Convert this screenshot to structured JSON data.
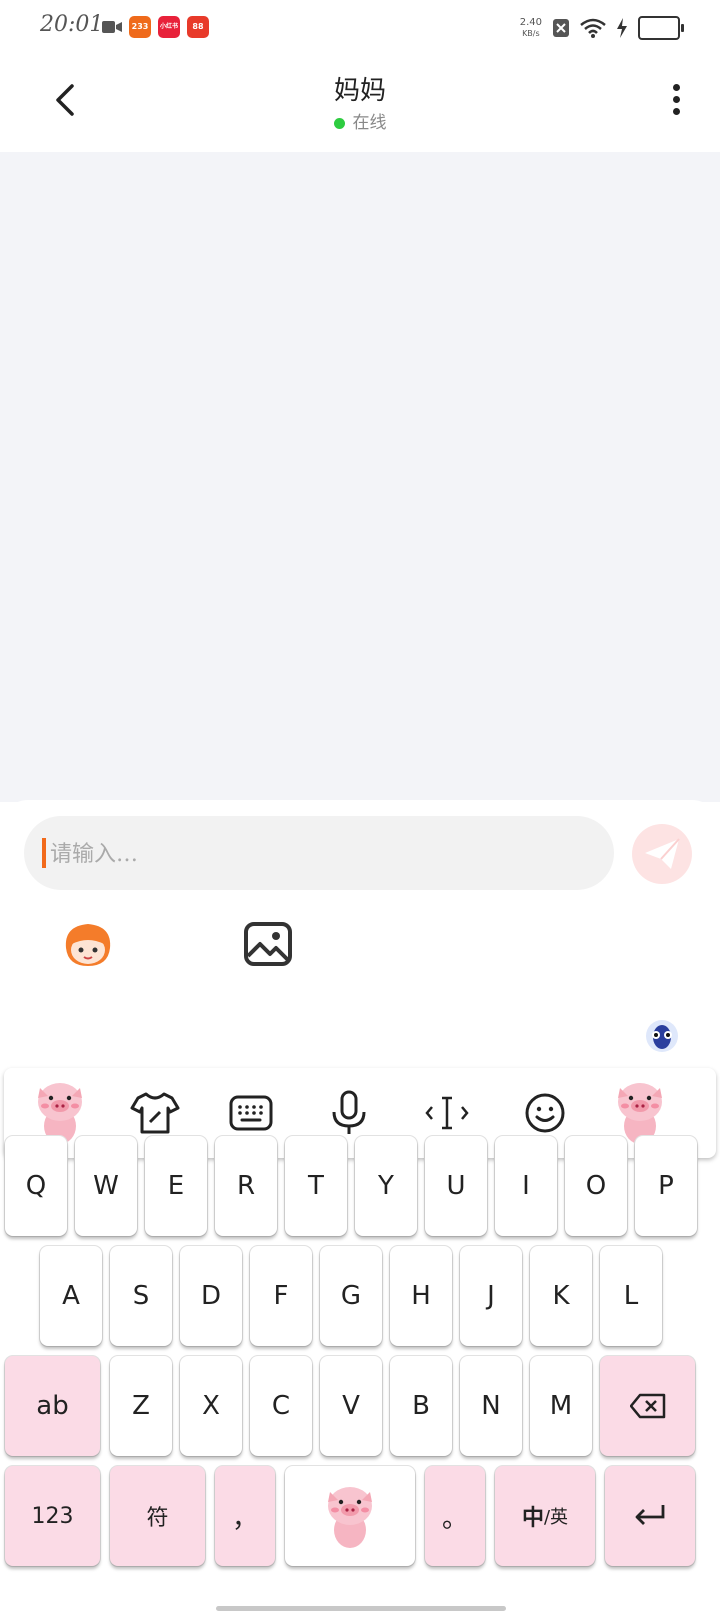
{
  "status_bar": {
    "time": "20:01",
    "app_badges": [
      "233",
      "小红书",
      "88"
    ],
    "net_speed_value": "2.40",
    "net_speed_unit": "KB/s"
  },
  "header": {
    "title": "妈妈",
    "status": "在线"
  },
  "input": {
    "placeholder": "请输入…"
  },
  "keyboard": {
    "row1": [
      "Q",
      "W",
      "E",
      "R",
      "T",
      "Y",
      "U",
      "I",
      "O",
      "P"
    ],
    "row2": [
      "A",
      "S",
      "D",
      "F",
      "G",
      "H",
      "J",
      "K",
      "L"
    ],
    "row3_left": "ab",
    "row3": [
      "Z",
      "X",
      "C",
      "V",
      "B",
      "N",
      "M"
    ],
    "bottom": {
      "numbers": "123",
      "symbols": "符",
      "comma": "，",
      "period": "。",
      "lang_main": "中",
      "lang_alt": "/英"
    }
  },
  "colors": {
    "accent_pink": "#fbdbe6",
    "online_green": "#2ecc40",
    "caret_orange": "#f26a1b",
    "chat_bg": "#f3f4f8"
  },
  "icons": [
    "back-arrow-icon",
    "more-vertical-icon",
    "send-icon",
    "avatar-sticker-icon",
    "image-icon",
    "ai-assistant-icon",
    "pig-sticker-icon",
    "skin-shirt-icon",
    "keyboard-icon",
    "microphone-icon",
    "cursor-move-icon",
    "emoji-icon",
    "backspace-icon",
    "enter-icon"
  ]
}
